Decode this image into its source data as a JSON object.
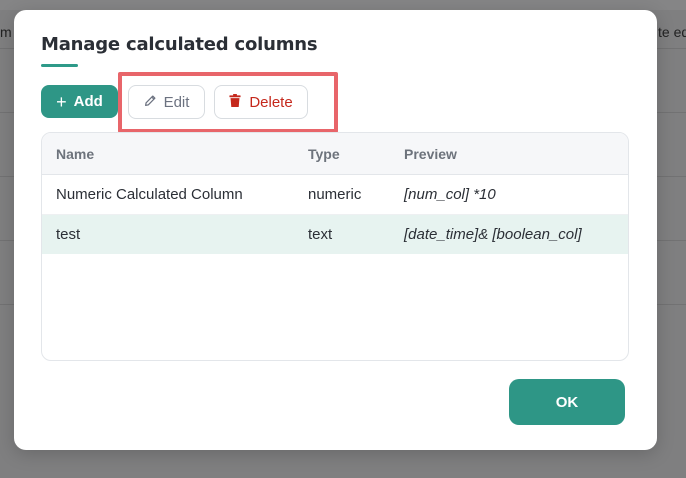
{
  "background": {
    "header_left_fragment": "m",
    "header_right_fragment": "te ed"
  },
  "dialog": {
    "title": "Manage calculated columns",
    "toolbar": {
      "add_label": "Add",
      "edit_label": "Edit",
      "delete_label": "Delete"
    },
    "table": {
      "columns": [
        "Name",
        "Type",
        "Preview"
      ],
      "rows": [
        {
          "name": "Numeric Calculated Column",
          "type": "numeric",
          "preview": "[num_col] *10",
          "selected": false
        },
        {
          "name": "test",
          "type": "text",
          "preview": "[date_time]& [boolean_col]",
          "selected": true
        }
      ]
    },
    "ok_label": "OK"
  },
  "colors": {
    "accent": "#2e9686",
    "danger": "#c5281c",
    "highlight_box": "#e8656a",
    "selected_row": "#e7f3f0"
  },
  "icons": {
    "add": "plus-icon",
    "edit": "pencil-icon",
    "delete": "trash-icon"
  }
}
